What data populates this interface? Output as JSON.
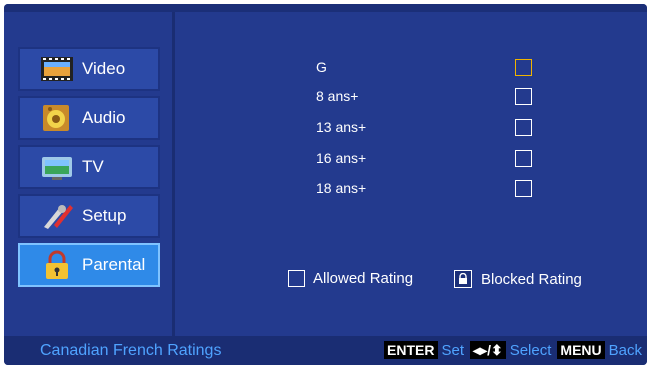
{
  "menu": {
    "items": [
      {
        "label": "Video",
        "icon": "film-icon"
      },
      {
        "label": "Audio",
        "icon": "speaker-icon"
      },
      {
        "label": "TV",
        "icon": "tv-antenna-icon"
      },
      {
        "label": "Setup",
        "icon": "tools-icon"
      },
      {
        "label": "Parental",
        "icon": "padlock-icon",
        "active": true
      }
    ]
  },
  "ratings": {
    "items": [
      {
        "label": "G",
        "focused": true
      },
      {
        "label": "8 ans+"
      },
      {
        "label": "13 ans+"
      },
      {
        "label": "16 ans+"
      },
      {
        "label": "18 ans+"
      }
    ]
  },
  "legend": {
    "allowed": "Allowed Rating",
    "blocked": "Blocked Rating"
  },
  "status": {
    "title": "Canadian French Ratings",
    "enter_key": "ENTER",
    "enter_text": "Set",
    "nav_key": "◂▸/⬍",
    "nav_text": "Select",
    "menu_key": "MENU",
    "menu_text": "Back"
  },
  "colors": {
    "background": "#233a8e",
    "active_item": "#2f8ae8",
    "focus_box": "#f0b400",
    "hint_text": "#4fa3ff"
  }
}
